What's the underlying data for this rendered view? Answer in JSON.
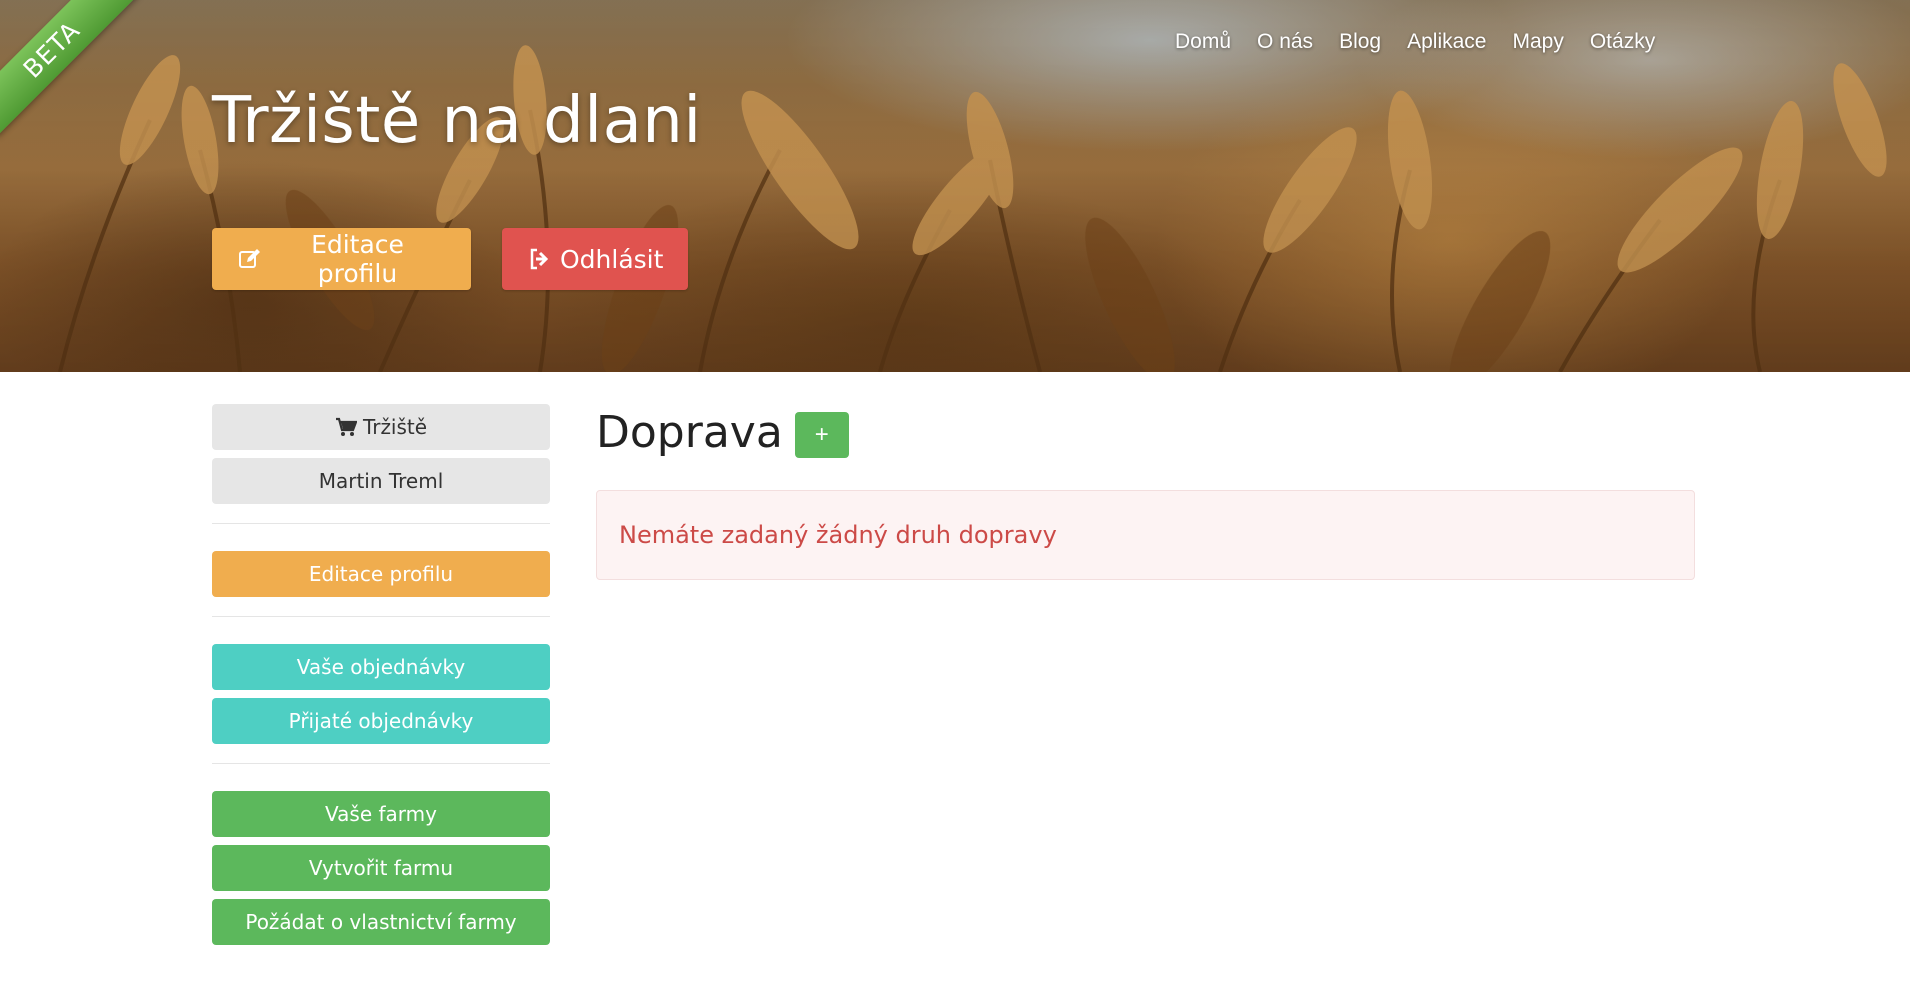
{
  "ribbon": {
    "label": "BETA"
  },
  "nav": {
    "items": [
      {
        "label": "Domů"
      },
      {
        "label": "O nás"
      },
      {
        "label": "Blog"
      },
      {
        "label": "Aplikace"
      },
      {
        "label": "Mapy"
      },
      {
        "label": "Otázky"
      }
    ]
  },
  "hero": {
    "title": "Tržiště na dlani",
    "edit_label": "Editace profilu",
    "edit_icon": "edit-icon",
    "logout_label": "Odhlásit",
    "logout_icon": "sign-out-icon"
  },
  "sidebar": {
    "market_label": "Tržiště",
    "market_icon": "shopping-cart-icon",
    "user_name": "Martin Treml",
    "edit_profile_label": "Editace profilu",
    "your_orders_label": "Vaše objednávky",
    "received_orders_label": "Přijaté objednávky",
    "your_farms_label": "Vaše farmy",
    "create_farm_label": "Vytvořit farmu",
    "request_farm_label": "Požádat o vlastnictví farmy"
  },
  "main": {
    "title": "Doprava",
    "add_label": "+",
    "empty_message": "Nemáte zadaný žádný druh dopravy"
  },
  "colors": {
    "orange": "#f0ad4e",
    "red": "#e0534f",
    "teal": "#4ecfc3",
    "green": "#5cb85c",
    "alert_text": "#cc4a47",
    "alert_bg": "#fdf3f3"
  }
}
